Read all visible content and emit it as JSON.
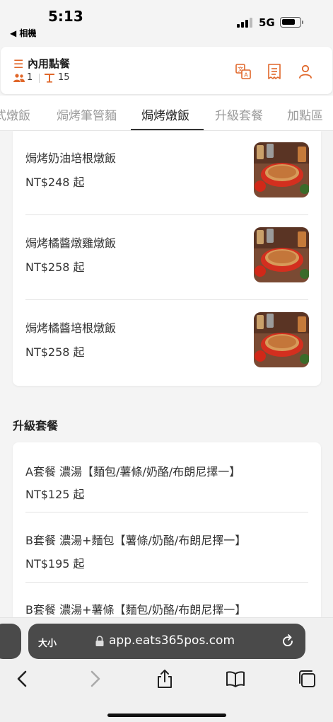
{
  "status_bar": {
    "time": "5:13",
    "back_label": "◀ 相機",
    "network": "5G",
    "battery_level": 0.8
  },
  "header": {
    "title": "內用點餐",
    "guest_count": "1",
    "table_number": "15",
    "icons": [
      "translate-icon",
      "receipt-icon",
      "user-icon"
    ],
    "accent_color": "#e0672a"
  },
  "tabs": [
    {
      "label": "式燉飯",
      "active": false
    },
    {
      "label": "焗烤筆管麵",
      "active": false
    },
    {
      "label": "焗烤燉飯",
      "active": true
    },
    {
      "label": "升級套餐",
      "active": false
    },
    {
      "label": "加點區",
      "active": false
    }
  ],
  "section1": {
    "items": [
      {
        "name": "焗烤奶油培根燉飯",
        "price": "NT$248 起"
      },
      {
        "name": "焗烤橘醬燉雞燉飯",
        "price": "NT$258 起"
      },
      {
        "name": "焗烤橘醬培根燉飯",
        "price": "NT$258 起"
      }
    ]
  },
  "section2": {
    "title": "升級套餐",
    "items": [
      {
        "name": "A套餐 濃湯【麵包/薯條/奶酪/布朗尼擇一】",
        "price": "NT$125 起"
      },
      {
        "name": "B套餐 濃湯+麵包【薯條/奶酪/布朗尼擇一】",
        "price": "NT$195 起"
      },
      {
        "name": "B套餐 濃湯+薯條【麵包/奶酪/布朗尼擇一】",
        "price": ""
      }
    ]
  },
  "browser": {
    "text_size_label": "大小",
    "url": "app.eats365pos.com"
  }
}
